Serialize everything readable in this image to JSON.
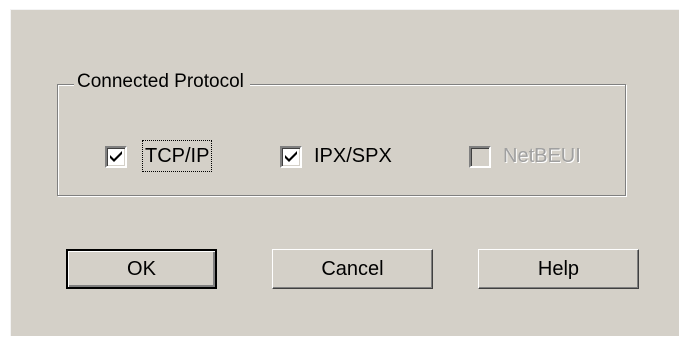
{
  "protocol_group": {
    "title": "Connected Protocol",
    "options": [
      {
        "label": "TCP/IP",
        "checked": true,
        "enabled": true,
        "focused": true
      },
      {
        "label": "IPX/SPX",
        "checked": true,
        "enabled": true,
        "focused": false
      },
      {
        "label": "NetBEUI",
        "checked": false,
        "enabled": false,
        "focused": false
      }
    ]
  },
  "buttons": {
    "ok": "OK",
    "cancel": "Cancel",
    "help": "Help"
  },
  "colors": {
    "face": "#d4d0c8",
    "shadow": "#808080",
    "highlight": "#ffffff",
    "disabled_text": "#a0a0a0"
  }
}
